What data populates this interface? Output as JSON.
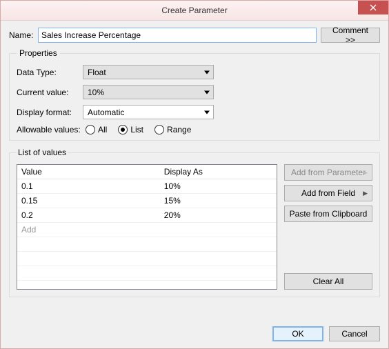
{
  "window": {
    "title": "Create Parameter"
  },
  "name_label": "Name:",
  "name_value": "Sales Increase Percentage",
  "comment_button": "Comment >>",
  "properties": {
    "legend": "Properties",
    "data_type_label": "Data Type:",
    "data_type_value": "Float",
    "current_value_label": "Current value:",
    "current_value_value": "10%",
    "display_format_label": "Display format:",
    "display_format_value": "Automatic",
    "allowable_label": "Allowable values:",
    "options": {
      "all": "All",
      "list": "List",
      "range": "Range"
    },
    "selected": "list"
  },
  "list_of_values": {
    "legend": "List of values",
    "headers": {
      "value": "Value",
      "display": "Display As"
    },
    "rows": [
      {
        "value": "0.1",
        "display": "10%"
      },
      {
        "value": "0.15",
        "display": "15%"
      },
      {
        "value": "0.2",
        "display": "20%"
      }
    ],
    "add_placeholder": "Add",
    "buttons": {
      "add_param": "Add from Parameter",
      "add_field": "Add from Field",
      "paste": "Paste from Clipboard",
      "clear": "Clear All"
    }
  },
  "footer": {
    "ok": "OK",
    "cancel": "Cancel"
  }
}
